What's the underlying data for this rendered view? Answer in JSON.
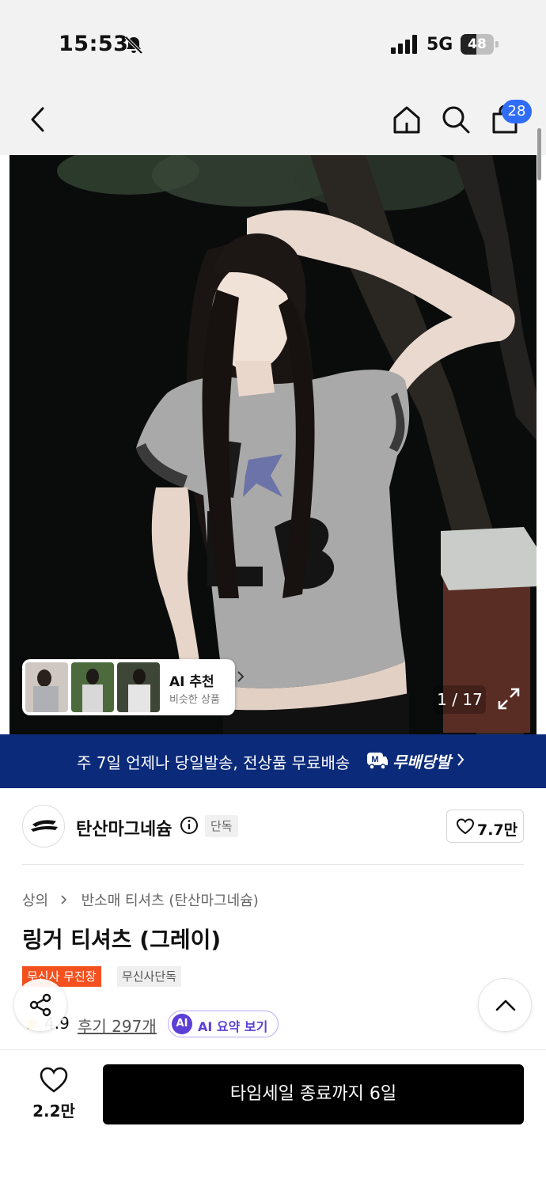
{
  "status_bar": {
    "time": "15:53",
    "network": "5G",
    "battery": "48",
    "battery_level": 0.48
  },
  "header": {
    "cart_count": "28",
    "icons": [
      "back-icon",
      "home-icon",
      "search-icon",
      "cart-icon"
    ]
  },
  "gallery": {
    "counter": "1 / 17",
    "ai_recommend": {
      "title": "AI 추천",
      "subtitle": "비슷한 상품"
    }
  },
  "shipping_banner": {
    "text": "주 7일 언제나 당일발송, 전상품 무료배송",
    "brand": "무배당발"
  },
  "brand": {
    "name": "탄산마그네슘",
    "tag": "단독",
    "likes": "7.7만"
  },
  "breadcrumb": {
    "category": "상의",
    "subcategory": "반소매 티셔츠 (탄산마그네슘)"
  },
  "product": {
    "title": "링거 티셔츠 (그레이)",
    "badges": [
      "무신사 무진장",
      "무신사단독"
    ],
    "rating": "4.9",
    "reviews": "후기 297개",
    "ai_summary": "AI 요약 보기",
    "ai_badge": "AI"
  },
  "bottom_bar": {
    "wish_count": "2.2만",
    "buy_label": "타임세일 종료까지 6일"
  },
  "colors": {
    "accent_blue": "#2f6df6",
    "banner_navy": "#0b2a7a",
    "badge_orange": "#f4511e",
    "ai_purple": "#5b3fd6"
  }
}
